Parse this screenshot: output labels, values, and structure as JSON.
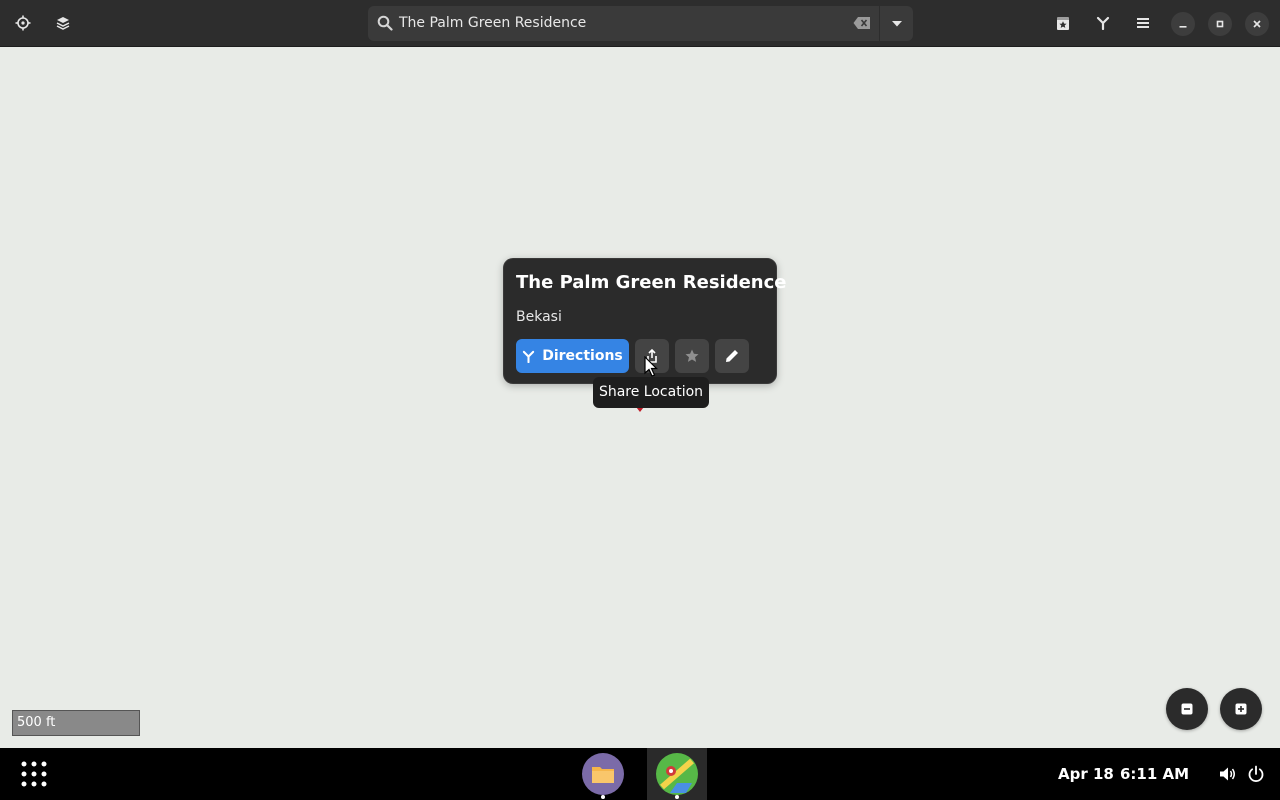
{
  "header": {
    "search_value": "The Palm Green Residence"
  },
  "place": {
    "title": "The Palm Green Residence",
    "subtitle": "Bekasi",
    "directions_label": "Directions",
    "tooltip": "Share Location"
  },
  "map": {
    "scale_label": "500 ft",
    "pin_color": "#c01c28",
    "accent": "#3584e4"
  },
  "taskbar": {
    "date": "Apr 18",
    "time": "6:11 AM"
  }
}
